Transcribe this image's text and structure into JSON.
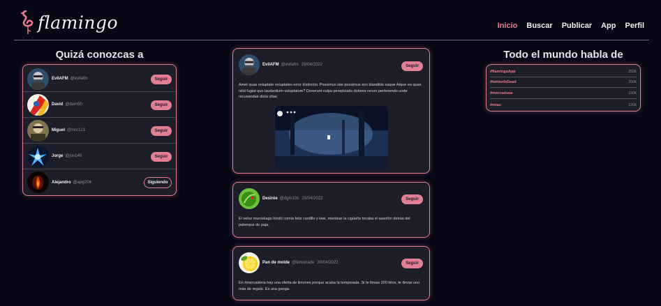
{
  "header": {
    "logo_text": "flamingo",
    "nav": [
      "Inicio",
      "Buscar",
      "Publicar",
      "App",
      "Perfil"
    ]
  },
  "suggestions": {
    "title": "Quizá conozcas a",
    "users": [
      {
        "name": "EvilAFM",
        "handle": "@evilafm",
        "button": "Seguir"
      },
      {
        "name": "David",
        "handle": "@dam50",
        "button": "Seguir"
      },
      {
        "name": "Miguel",
        "handle": "@mrc121",
        "button": "Seguir"
      },
      {
        "name": "Jorge",
        "handle": "@jov148",
        "button": "Seguir"
      },
      {
        "name": "Alejandro",
        "handle": "@apg204",
        "button": "Siguiendo"
      }
    ]
  },
  "posts": [
    {
      "name": "EvilAFM",
      "handle": "@evilafm",
      "date": "29/04/2022",
      "button": "Seguir",
      "text": "Amet quas voluptate voluptates error distinctio. Possimus iste possimus eos blanditiis eaque Atque ea quas nihil fugiat quo laudantium voluptatum? Deserunt culpa perspiciatis dolores rerum pertenendo unde recusandae dicta vitae."
    },
    {
      "name": "Desirée",
      "handle": "@dgm101",
      "date": "29/04/2022",
      "button": "Seguir",
      "text": "El veloz murciélago hindú comía feliz cardillo y kiwi, mientras la cigüeña tocaba el saxofón detrás del palenque de paja."
    },
    {
      "name": "Pan de molde",
      "handle": "@lemonade",
      "date": "30/04/2022",
      "button": "Seguir",
      "text": "En #mercadona hay una oferta de limones porque acaba la temporada. Si te llevas 200 kilos, te llevas uno más de regalo. Es una ganga."
    }
  ],
  "trends": {
    "title": "Todo el mundo habla de",
    "items": [
      {
        "tag": "#flamingoApp",
        "count": "253K"
      },
      {
        "tag": "#twitterIsDead",
        "count": "200K"
      },
      {
        "tag": "#mercadona",
        "count": "150K"
      },
      {
        "tag": "#miau",
        "count": "125K"
      }
    ]
  },
  "colors": {
    "accent": "#e27f94",
    "background": "#070716",
    "panel": "#1e1d2a"
  }
}
